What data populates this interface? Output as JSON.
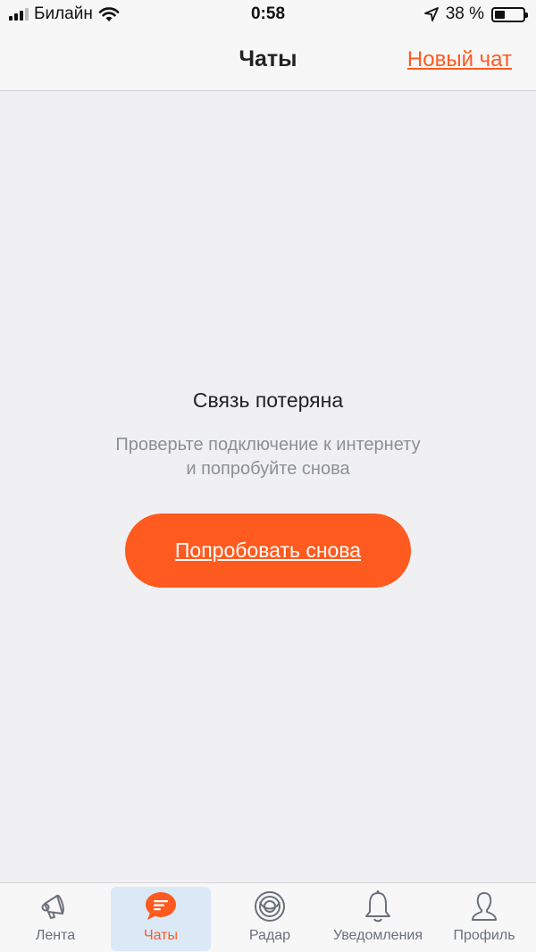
{
  "status_bar": {
    "carrier": "Билайн",
    "time": "0:58",
    "battery": "38 %",
    "battery_level": 0.38
  },
  "nav": {
    "title": "Чаты",
    "new_chat": "Новый чат"
  },
  "error": {
    "title": "Связь потеряна",
    "line1": "Проверьте подключение к интернету",
    "line2": "и попробуйте снова",
    "retry": "Попробовать снова"
  },
  "tabs": [
    {
      "label": "Лента",
      "icon": "megaphone-icon",
      "active": false
    },
    {
      "label": "Чаты",
      "icon": "chat-bubble-icon",
      "active": true
    },
    {
      "label": "Радар",
      "icon": "radar-icon",
      "active": false
    },
    {
      "label": "Уведомления",
      "icon": "bell-icon",
      "active": false
    },
    {
      "label": "Профиль",
      "icon": "person-icon",
      "active": false
    }
  ],
  "colors": {
    "accent": "#ff5a1f",
    "background": "#f0f0f2",
    "bar": "#f7f7f8",
    "active_tab_bg": "#dbe9f7",
    "muted_text": "#8a9097"
  }
}
